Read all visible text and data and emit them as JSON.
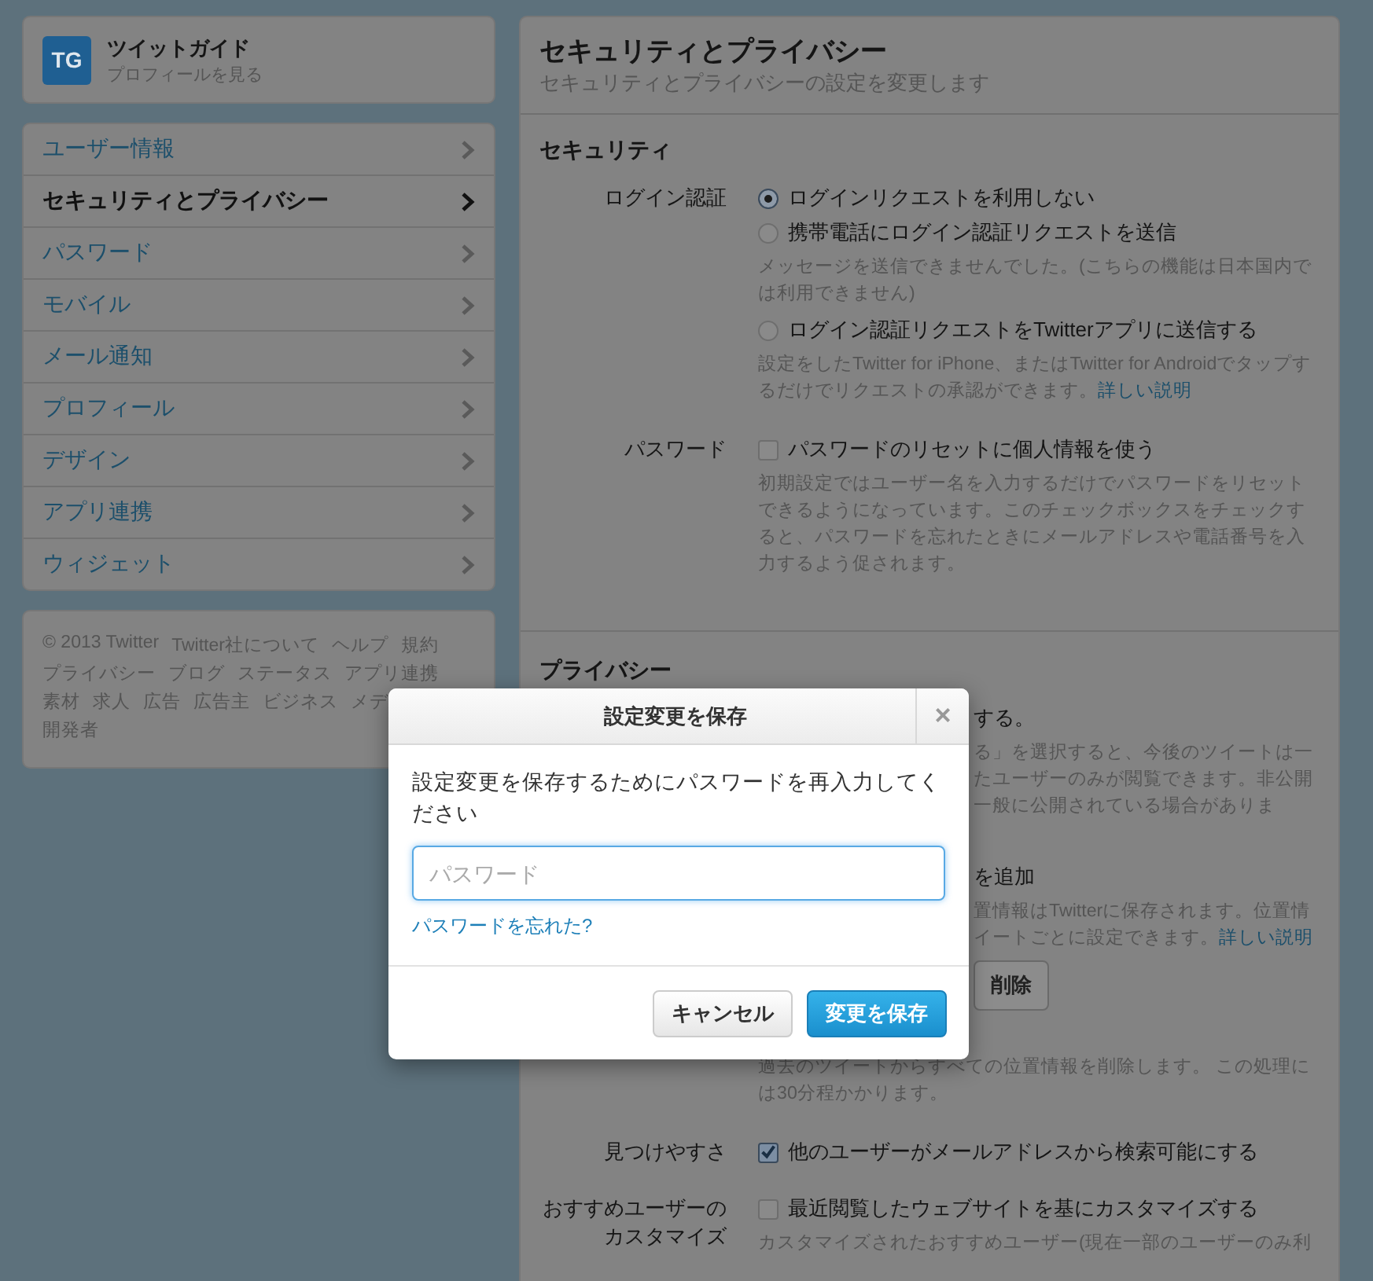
{
  "profile": {
    "logo": "TG",
    "name": "ツイットガイド",
    "link": "プロフィールを見る"
  },
  "nav": [
    {
      "label": "ユーザー情報",
      "selected": false
    },
    {
      "label": "セキュリティとプライバシー",
      "selected": true
    },
    {
      "label": "パスワード",
      "selected": false
    },
    {
      "label": "モバイル",
      "selected": false
    },
    {
      "label": "メール通知",
      "selected": false
    },
    {
      "label": "プロフィール",
      "selected": false
    },
    {
      "label": "デザイン",
      "selected": false
    },
    {
      "label": "アプリ連携",
      "selected": false
    },
    {
      "label": "ウィジェット",
      "selected": false
    }
  ],
  "footer_links": [
    "© 2013 Twitter",
    "Twitter社について",
    "ヘルプ",
    "規約",
    "プライバシー",
    "ブログ",
    "ステータス",
    "アプリ連携",
    "素材",
    "求人",
    "広告",
    "広告主",
    "ビジネス",
    "メデ",
    "開発者"
  ],
  "main": {
    "title": "セキュリティとプライバシー",
    "subtitle": "セキュリティとプライバシーの設定を変更します"
  },
  "security": {
    "heading": "セキュリティ",
    "rows": [
      {
        "label": "ログイン認証",
        "kind": "radio",
        "options": [
          {
            "label": "ログインリクエストを利用しない",
            "selected": true
          },
          {
            "label": "携帯電話にログイン認証リクエストを送信",
            "selected": false,
            "note": "メッセージを送信できませんでした。(こちらの機能は日本国内では利用できません)"
          },
          {
            "label": "ログイン認証リクエストをTwitterアプリに送信する",
            "selected": false,
            "note": "設定をしたTwitter for iPhone、またはTwitter for Androidでタップするだけでリクエストの承認ができます。",
            "note_link": "詳しい説明"
          }
        ]
      },
      {
        "label": "パスワード",
        "kind": "checkbox",
        "options": [
          {
            "label": "パスワードのリセットに個人情報を使う",
            "checked": false,
            "note": "初期設定ではユーザー名を入力するだけでパスワードをリセットできるようになっています。このチェックボックスをチェックすると、パスワードを忘れたときにメールアドレスや電話番号を入力するよう促されます。"
          }
        ]
      }
    ]
  },
  "privacy": {
    "heading": "プライバシー",
    "fragments": [
      {
        "kind": "option",
        "text": "する。"
      },
      {
        "kind": "note",
        "text": "る」を選択すると、今後のツイートは一"
      },
      {
        "kind": "note",
        "text": "たユーザーのみが閲覧できます。非公開"
      },
      {
        "kind": "note",
        "text": "一般に公開されている場合がありま"
      },
      {
        "kind": "option",
        "text": "を追加"
      },
      {
        "kind": "note",
        "text": "置情報はTwitterに保存されます。位置情"
      },
      {
        "kind": "note",
        "text": "イートごとに設定できます。",
        "link": "詳しい説明"
      },
      {
        "kind": "button",
        "text": "削除"
      }
    ],
    "note": "過去のツイートからすべての位置情報を削除します。 この処理には30分程かかります。",
    "rows": [
      {
        "label": "見つけやすさ",
        "kind": "checkbox",
        "options": [
          {
            "label": "他のユーザーがメールアドレスから検索可能にする",
            "checked": true
          }
        ]
      },
      {
        "label": "おすすめユーザーのカスタマイズ",
        "kind": "checkbox",
        "options": [
          {
            "label": "最近閲覧したウェブサイトを基にカスタマイズする",
            "checked": false,
            "note": "カスタマイズされたおすすめユーザー(現在一部のユーザーのみ利"
          }
        ]
      }
    ]
  },
  "dialog": {
    "title": "設定変更を保存",
    "close": "×",
    "message": "設定変更を保存するためにパスワードを再入力してください",
    "placeholder": "パスワード",
    "forgot": "パスワードを忘れた?",
    "buttons": [
      {
        "kind": "cancel",
        "label": "キャンセル"
      },
      {
        "kind": "primary",
        "label": "変更を保存"
      }
    ]
  }
}
